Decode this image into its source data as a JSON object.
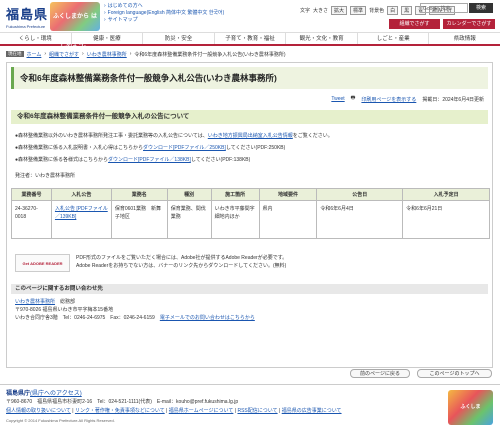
{
  "header": {
    "logo_title": "福島県",
    "logo_sub": "Fukushima Prefecture",
    "mascot_text": "ふくしまから はじめよう。",
    "links": [
      "はじめての方へ",
      "Foreign language(English 简体中文 繁體中文 한국어)",
      "サイトマップ"
    ],
    "tools": [
      "文字",
      "大きさ",
      "拡大",
      "標準",
      "背景色",
      "白",
      "黒",
      "青",
      "読み上げ"
    ],
    "search_placeholder": "Google 検索",
    "search_button": "検索",
    "btn_org": "組織でさがす",
    "btn_calendar": "カレンダーでさがす"
  },
  "nav": [
    "くらし・環境",
    "健康・医療",
    "防災・安全",
    "子育て・教育・福祉",
    "観光・文化・教育",
    "しごと・産業",
    "県政情報"
  ],
  "breadcrumb": {
    "here": "現在地",
    "items": [
      "ホーム",
      "組織でさがす",
      "いわき農林事務所",
      "令和6年度森林整備業務条件付一般競争入札公告(いわき農林事務所)"
    ]
  },
  "page": {
    "title": "令和6年度森林整備業務条件付一般競争入札公告(いわき農林事務所)",
    "tweet": "Tweet",
    "print": "印刷用ページを表示する",
    "posted": "掲載日：2024年6月4日更新",
    "section": "令和6年度森林整備業務条件付一般競争入札の公告について",
    "p1a": "●森林整備業務以外のいわき農林事務所発注工事・委託業務等の入札公告については、",
    "p1link": "いわき地方振興局出納室入札公告情報",
    "p1b": "をご覧ください。",
    "p2a": "●森林整備業務に係る入札説明書・入札心得はこちらから",
    "p2link1": "ダウンロード",
    "p2link2": "[PDFファイル／250KB]",
    "p2b": "してください(PDF:250KB)",
    "p3a": "●森林整備業務に係る各様式はこちらから",
    "p3link1": "ダウンロード",
    "p3link2": "[PDFファイル／138KB]",
    "p3b": "してください(PDF:138KB)",
    "issuer": "発注者：いわき農林事務所"
  },
  "table": {
    "headers": [
      "業務番号",
      "入札公告",
      "業務名",
      "種別",
      "施工箇所",
      "地域要件",
      "公告日",
      "入札予定日"
    ],
    "row": {
      "no": "24-36270-0018",
      "notice_link1": "入札公告 [PDFファイル／139KB]",
      "name": "保育0601業務　新舞子地区",
      "type": "保育業務、間伐業務",
      "place": "いわき市平藤間字細地内ほか",
      "region": "県内",
      "notice_date": "令和6年6月4日",
      "bid_date": "令和6年6月21日"
    }
  },
  "pdf": {
    "badge": "Get ADOBE READER",
    "line1": "PDF形式のファイルをご覧いただく場合には、Adobe社が提供するAdobe Readerが必要です。",
    "line2": "Adobe Readerをお持ちでない方は、バナーのリンク先からダウンロードしてください。(無料)"
  },
  "inquiry": {
    "head": "このページに関するお問い合わせ先",
    "office": "いわき農林事務所",
    "dept": "　総務部",
    "addr": "〒970-8026 福島県いわき市平字梅本15番地",
    "tel": "いわき合同庁舎3階　Tel：0246-24-6975　Fax：0246-24-6159",
    "mail_link": "電子メールでのお問い合わせはこちらから"
  },
  "pager": {
    "top": "前のページに戻る",
    "page_top": "このページのトップへ"
  },
  "footer": {
    "title": "福島県庁",
    "access": "(県庁へのアクセス)",
    "addr": "〒960-8670　福島県福島市杉妻町2-16　Tel：024-521-1111(代表)　E-mail：kouho@pref.fukushima.lg.jp",
    "links": [
      "個人情報の取り扱いについて",
      "リンク・著作権・免責事項などについて",
      "福島県ホームページについて",
      "RSS配信について",
      "福島県の広告事業について"
    ],
    "copyright": "Copyright © 2014 Fukushima Prefecture.All Rights Reserved.",
    "logo_text": "ふくしま"
  },
  "colors": {
    "brand": "#b4223a",
    "green": "#6aa84f",
    "link": "#1a56b0"
  }
}
